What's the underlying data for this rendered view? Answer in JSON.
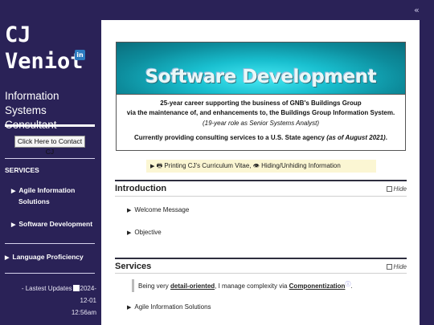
{
  "sidebar": {
    "name_first": "CJ",
    "name_last": "Veniot",
    "linkedin_icon_text": "in",
    "role": "Information Systems Consultant",
    "contact_button": "Click Here to Contact CJ",
    "services_heading": "SERVICES",
    "service_items": [
      {
        "label_1": "Agile Information",
        "label_2": "Solutions"
      },
      {
        "label_1": "Software Development"
      }
    ],
    "language_item": "Language Proficiency",
    "updated_prefix": "- Lastest Updates",
    "updated_date": "2024-12-01",
    "updated_time": "12:56am"
  },
  "collapse_icon": "«",
  "banner": {
    "title": "Software Development",
    "line1": "25-year career supporting the business of GNB's Buildings Group",
    "line2": "via the maintenance of, and enhancements to, the Buildings Group Information System.",
    "line3": "(19-year role as Senior Systems Analyst)",
    "line4_main": "Currently providing consulting services to a U.S. State agency",
    "line4_italic": "(as of August 2021)",
    "line4_end": "."
  },
  "printbar": {
    "print_icon": "🖶",
    "print_label": "Printing CJ's Curriculum Vitae,",
    "hide_icon": "👁",
    "hide_label": "Hiding/Unhiding Information"
  },
  "sections": {
    "introduction": {
      "title": "Introduction",
      "hide_label": "Hide",
      "items": [
        "Welcome Message",
        "Objective"
      ]
    },
    "services": {
      "title": "Services",
      "hide_label": "Hide",
      "quote_pre": "Being very",
      "quote_em": "detail-oriented",
      "quote_mid": ", I manage complexity via",
      "quote_link": "Componentization",
      "quote_info": "ⓘ",
      "quote_end": ".",
      "items": [
        "Agile Information Solutions"
      ]
    }
  },
  "colors": {
    "sidebar_bg": "#2a2257",
    "banner_cyan": "#19bfcf",
    "printbar_bg": "#fbf6d3"
  }
}
